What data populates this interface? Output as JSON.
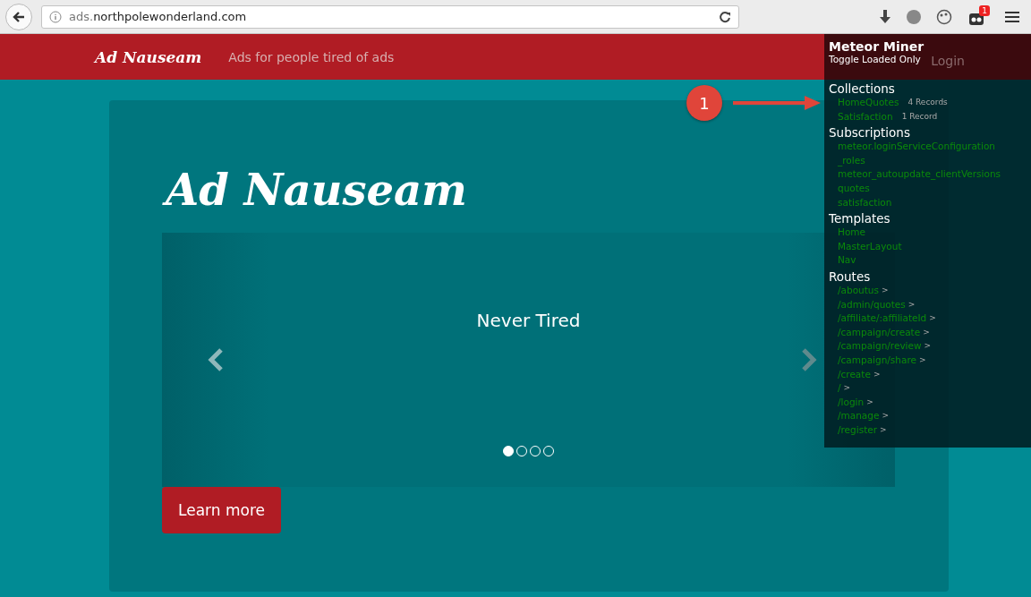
{
  "browser": {
    "url_prefix": "ads.",
    "url_main": "northpolewonderland.com",
    "badge": "1"
  },
  "navbar": {
    "brand": "Ad Nauseam",
    "tagline": "Ads for people tired of ads",
    "login": "Login"
  },
  "hero": {
    "title": "Ad Nauseam",
    "caption": "Never Tired",
    "indicators": [
      {
        "selected": true
      },
      {
        "selected": false
      },
      {
        "selected": false
      },
      {
        "selected": false
      }
    ],
    "button": "Learn more"
  },
  "miner": {
    "title": "Meteor Miner",
    "toggle": "Toggle Loaded Only",
    "collections": {
      "heading": "Collections",
      "items": [
        {
          "name": "HomeQuotes",
          "count": "4 Records"
        },
        {
          "name": "Satisfaction",
          "count": "1 Record"
        }
      ]
    },
    "subscriptions": {
      "heading": "Subscriptions",
      "items": [
        "meteor.loginServiceConfiguration",
        "_roles",
        "meteor_autoupdate_clientVersions",
        "quotes",
        "satisfaction"
      ]
    },
    "templates": {
      "heading": "Templates",
      "items": [
        "Home",
        "MasterLayout",
        "Nav"
      ]
    },
    "routes": {
      "heading": "Routes",
      "items": [
        {
          "path": "/aboutus",
          "arrow": ">"
        },
        {
          "path": "/admin/quotes",
          "arrow": ">"
        },
        {
          "path": "/affiliate/:affiliateId",
          "arrow": ">"
        },
        {
          "path": "/campaign/create",
          "arrow": ">"
        },
        {
          "path": "/campaign/review",
          "arrow": ">"
        },
        {
          "path": "/campaign/share",
          "arrow": ">"
        },
        {
          "path": "/create",
          "arrow": ">"
        },
        {
          "path": "/",
          "arrow": ">"
        },
        {
          "path": "/login",
          "arrow": ">"
        },
        {
          "path": "/manage",
          "arrow": ">"
        },
        {
          "path": "/register",
          "arrow": ">"
        }
      ]
    }
  },
  "annotation": {
    "number": "1"
  }
}
